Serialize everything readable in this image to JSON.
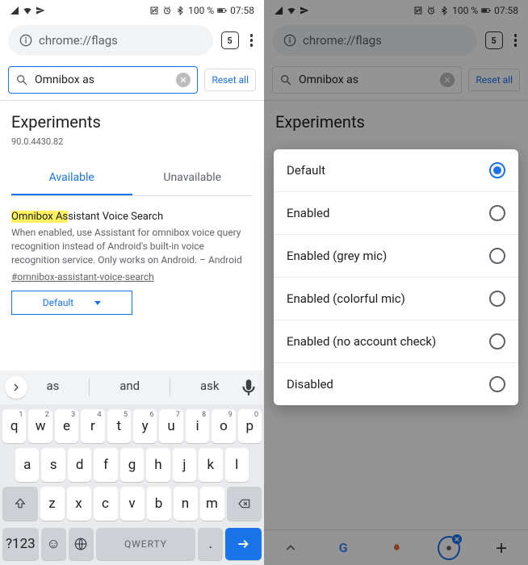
{
  "statusbar": {
    "battery": "100 %",
    "time": "07:58"
  },
  "urlbar": {
    "url": "chrome://flags",
    "tab_count": "5"
  },
  "search": {
    "query": "Omnibox as",
    "reset_label": "Reset all"
  },
  "experiments": {
    "title": "Experiments",
    "version": "90.0.4430.82",
    "tabs": {
      "available": "Available",
      "unavailable": "Unavailable"
    }
  },
  "flag": {
    "title_hl": "Omnibox As",
    "title_rest": "sistant Voice Search",
    "description": "When enabled, use Assistant for omnibox voice query recognition instead of Android's built-in voice recognition service. Only works on Android. – Android",
    "hash": "#omnibox-assistant-voice-search",
    "select_value": "Default"
  },
  "keyboard": {
    "suggestions": [
      "as",
      "and",
      "ask"
    ],
    "row1": [
      {
        "c": "q",
        "n": "1"
      },
      {
        "c": "w",
        "n": "2"
      },
      {
        "c": "e",
        "n": "3"
      },
      {
        "c": "r",
        "n": "4"
      },
      {
        "c": "t",
        "n": "5"
      },
      {
        "c": "y",
        "n": "6"
      },
      {
        "c": "u",
        "n": "7"
      },
      {
        "c": "i",
        "n": "8"
      },
      {
        "c": "o",
        "n": "9"
      },
      {
        "c": "p",
        "n": "0"
      }
    ],
    "row2": [
      "a",
      "s",
      "d",
      "f",
      "g",
      "h",
      "j",
      "k",
      "l"
    ],
    "row3": [
      "z",
      "x",
      "c",
      "v",
      "b",
      "n",
      "m"
    ],
    "symkey": "?123",
    "space": "QWERTY"
  },
  "dropdown": {
    "options": [
      {
        "label": "Default",
        "selected": true
      },
      {
        "label": "Enabled",
        "selected": false
      },
      {
        "label": "Enabled (grey mic)",
        "selected": false
      },
      {
        "label": "Enabled (colorful mic)",
        "selected": false
      },
      {
        "label": "Enabled (no account check)",
        "selected": false
      },
      {
        "label": "Disabled",
        "selected": false
      }
    ]
  }
}
